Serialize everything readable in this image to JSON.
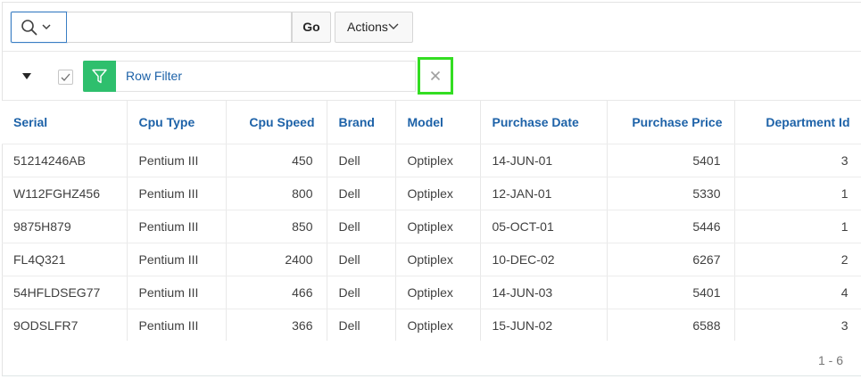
{
  "search": {
    "value": "",
    "placeholder": "",
    "go_label": "Go"
  },
  "toolbar": {
    "actions_label": "Actions"
  },
  "filter": {
    "label": "Row Filter",
    "enabled": true
  },
  "table": {
    "columns": [
      "Serial",
      "Cpu Type",
      "Cpu Speed",
      "Brand",
      "Model",
      "Purchase Date",
      "Purchase Price",
      "Department Id"
    ],
    "rows": [
      [
        "51214246AB",
        "Pentium III",
        "450",
        "Dell",
        "Optiplex",
        "14-JUN-01",
        "5401",
        "3"
      ],
      [
        "W112FGHZ456",
        "Pentium III",
        "800",
        "Dell",
        "Optiplex",
        "12-JAN-01",
        "5330",
        "1"
      ],
      [
        "9875H879",
        "Pentium III",
        "850",
        "Dell",
        "Optiplex",
        "05-OCT-01",
        "5446",
        "1"
      ],
      [
        "FL4Q321",
        "Pentium III",
        "2400",
        "Dell",
        "Optiplex",
        "10-DEC-02",
        "6267",
        "2"
      ],
      [
        "54HFLDSEG77",
        "Pentium III",
        "466",
        "Dell",
        "Optiplex",
        "14-JUN-03",
        "5401",
        "4"
      ],
      [
        "9ODSLFR7",
        "Pentium III",
        "366",
        "Dell",
        "Optiplex",
        "15-JUN-02",
        "6588",
        "3"
      ]
    ]
  },
  "pagination": {
    "label": "1 - 6"
  },
  "colors": {
    "link_blue": "#1d62a8",
    "filter_green": "#2ebf6d",
    "highlight_green": "#33dd22",
    "focus_blue": "#3b7fc4"
  },
  "icons": {
    "search": "search-icon",
    "chevron": "chevron-down-icon",
    "collapse": "triangle-down-icon",
    "check": "check-icon",
    "filter": "funnel-icon",
    "remove": "close-icon"
  }
}
